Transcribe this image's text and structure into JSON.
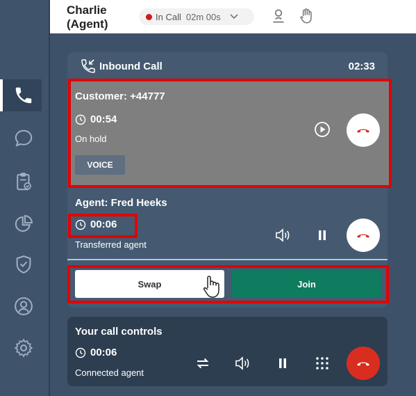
{
  "topbar": {
    "agent_name": "Charlie (Agent)",
    "status_label": "In Call",
    "status_duration": "02m 00s",
    "status_color": "#d21818"
  },
  "sidebar": {
    "items": [
      {
        "icon": "phone-icon",
        "active": true
      },
      {
        "icon": "chat-icon"
      },
      {
        "icon": "clipboard-check-icon"
      },
      {
        "icon": "pie-chart-icon"
      },
      {
        "icon": "shield-check-icon"
      },
      {
        "icon": "user-circle-icon"
      },
      {
        "icon": "gear-icon"
      }
    ]
  },
  "call_panel": {
    "title": "Inbound Call",
    "timer": "02:33"
  },
  "customer": {
    "title": "Customer: +44777",
    "duration": "00:54",
    "status": "On hold",
    "channel_tag": "VOICE"
  },
  "agent": {
    "title": "Agent: Fred Heeks",
    "duration": "00:06",
    "status": "Transferred agent"
  },
  "actions": {
    "swap_label": "Swap",
    "join_label": "Join",
    "join_color": "#0f7b5f"
  },
  "controls": {
    "title": "Your call controls",
    "duration": "00:06",
    "status": "Connected agent"
  },
  "colors": {
    "highlight": "#e50000",
    "hangup_red": "#d92d20"
  }
}
